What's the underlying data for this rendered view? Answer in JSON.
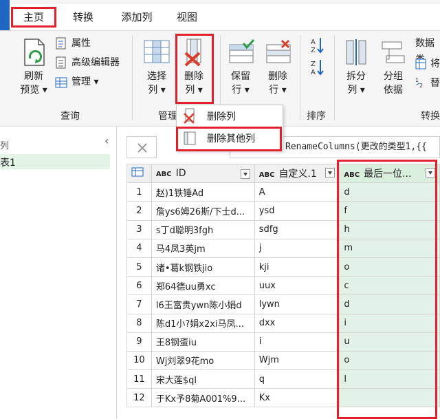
{
  "tabs": [
    {
      "label": "主页",
      "active": true
    },
    {
      "label": "转换",
      "active": false
    },
    {
      "label": "添加列",
      "active": false
    },
    {
      "label": "视图",
      "active": false
    }
  ],
  "ribbon": {
    "refresh_preview": {
      "line1": "刷新",
      "line2": "预览 ▾"
    },
    "properties": "属性",
    "advanced_editor": "高级编辑器",
    "manage": "管理 ▾",
    "query_group": "查询",
    "choose_columns": {
      "line1": "选择",
      "line2": "列 ▾"
    },
    "remove_columns": {
      "line1": "删除",
      "line2": "列 ▾"
    },
    "manage_group": "管理",
    "keep_rows": {
      "line1": "保留",
      "line2": "行 ▾"
    },
    "remove_rows": {
      "line1": "删除",
      "line2": "行 ▾"
    },
    "sort_group": "排序",
    "split_column": {
      "line1": "拆分",
      "line2": "列 ▾"
    },
    "group_by": {
      "line1": "分组",
      "line2": "依据"
    },
    "data_type": "数据类",
    "use_first_row": "将",
    "replace_values": "替",
    "transform_group": "转换"
  },
  "menu": {
    "remove_columns": "删除列",
    "remove_other_columns": "删除其他列"
  },
  "left_pane": {
    "header_char": "列",
    "selected_query": "表1"
  },
  "formula": {
    "text": "RenameColumns(更改的类型1,{{"
  },
  "table": {
    "headers": [
      "ID",
      "自定义.1",
      "最后一位..."
    ],
    "type_badge": "ABC",
    "rows": [
      {
        "n": "1",
        "id": "赵)1铁锤Ad",
        "c1": "A",
        "last": "d"
      },
      {
        "n": "2",
        "id": "詹ys6姆26斯/下士d...",
        "c1": "ysd",
        "last": "f"
      },
      {
        "n": "3",
        "id": "s丁d聪明3fgh",
        "c1": "sdfg",
        "last": "h"
      },
      {
        "n": "4",
        "id": "马4凤3英jm",
        "c1": "j",
        "last": "m"
      },
      {
        "n": "5",
        "id": "诸•葛k钢铁jio",
        "c1": "kji",
        "last": "o"
      },
      {
        "n": "6",
        "id": "郑64德uu勇xc",
        "c1": "uux",
        "last": "c"
      },
      {
        "n": "7",
        "id": "l6王富贵ywn陈小娟d",
        "c1": "lywn",
        "last": "d"
      },
      {
        "n": "8",
        "id": "陈d1小?娟x2xi马凤...",
        "c1": "dxx",
        "last": "i"
      },
      {
        "n": "9",
        "id": "王8钢蛋iu",
        "c1": "i",
        "last": "u"
      },
      {
        "n": "10",
        "id": "Wj刘翠9花mo",
        "c1": "Wjm",
        "last": "o"
      },
      {
        "n": "11",
        "id": "宋大莲$ql",
        "c1": "q",
        "last": "l"
      },
      {
        "n": "12",
        "id": "于Kx予8菊A001%9...",
        "c1": "Kx",
        "last": ""
      }
    ]
  },
  "colors": {
    "highlight_red": "#e0202a",
    "selected_green": "#e2f2e6",
    "ribbon_bg": "#f5f5f5",
    "accent_blue": "#1f66c1"
  }
}
